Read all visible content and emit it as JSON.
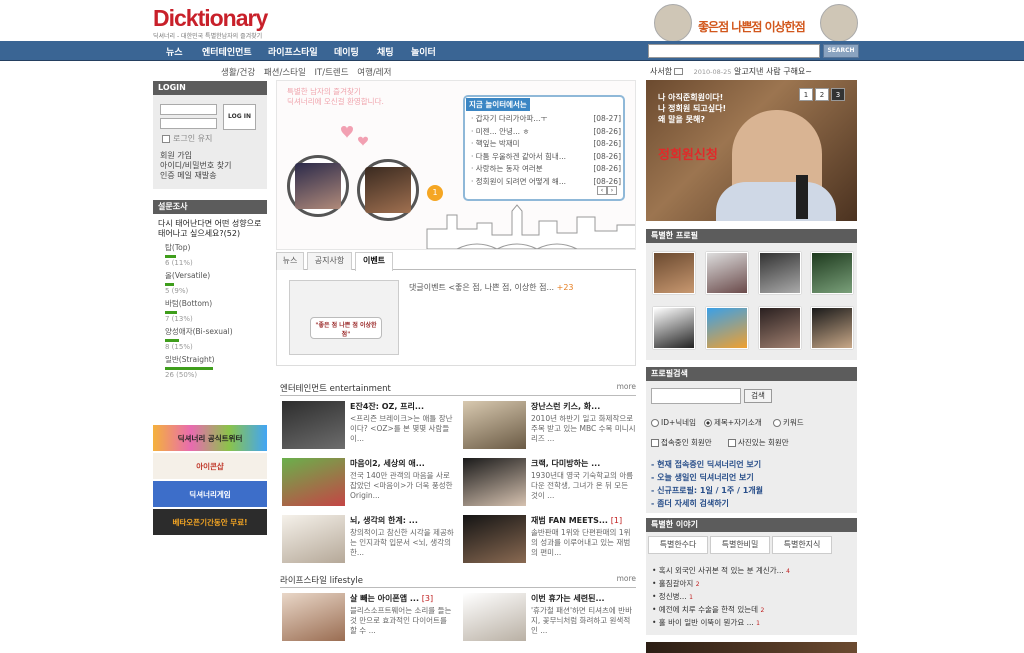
{
  "header": {
    "logo": "Dicktionary",
    "tagline": "딕셔너리 - 대한민국 특별한남자의 즐겨찾기",
    "promo_text": "좋은점 나쁜점 이상한점"
  },
  "nav": {
    "items": [
      "뉴스",
      "엔터테인먼트",
      "라이프스타일",
      "데이팅",
      "채팅",
      "놀이터"
    ],
    "search_button": "SEARCH",
    "search_placeholder": ""
  },
  "subnav": [
    "생활/건강",
    "패션/스타일",
    "IT/트렌드",
    "여행/레저"
  ],
  "login": {
    "title": "LOGIN",
    "button": "LOG IN",
    "keep_login": "로그인 유지",
    "links": [
      "회원 가입",
      "아이디/비밀번호 찾기",
      "인증 메일 재발송"
    ]
  },
  "poll": {
    "title": "설문조사",
    "question": "다시 태어난다면 어떤 성향으로 태어나고 싶으세요?(52)",
    "options": [
      {
        "label": "탑(Top)",
        "result": "6 (11%)",
        "pct": 11
      },
      {
        "label": "올(Versatile)",
        "result": "5 (9%)",
        "pct": 9
      },
      {
        "label": "바텀(Bottom)",
        "result": "7 (13%)",
        "pct": 13
      },
      {
        "label": "양성애자(Bi-sexual)",
        "result": "8 (15%)",
        "pct": 15
      },
      {
        "label": "일반(Straight)",
        "result": "26 (50%)",
        "pct": 50
      }
    ]
  },
  "left_banners": [
    "딕셔너리 공식트위터",
    "아이콘샵",
    "딕셔너리게임",
    "베타오픈기간동안 무료!"
  ],
  "hero": {
    "note_line1": "특별한 남자의 즐겨찾기",
    "note_line2": "딕셔너리에 오신걸 환영합니다.",
    "popup_title": "지금 놀이터에서는",
    "popup_items": [
      {
        "text": "갑자기 다리가아파...ㅜ",
        "date": "[08-27]"
      },
      {
        "text": "미젠... 안녕... ㅎ",
        "date": "[08-26]"
      },
      {
        "text": "핵잎는 박재미",
        "date": "[08-26]"
      },
      {
        "text": "다툼 우울하겐 같아서 힘내...",
        "date": "[08-26]"
      },
      {
        "text": "사랑하는 동자 여러분",
        "date": "[08-26]"
      },
      {
        "text": "정회원이 되려면 어떻게 해...",
        "date": "[08-26]"
      }
    ],
    "tv_labels": [
      "오늘의 인물",
      "신규회원 환영"
    ],
    "tv_badge": "1"
  },
  "tabs": [
    "뉴스",
    "공지사항",
    "이벤트"
  ],
  "event": {
    "image_caption": "\"좋은 점 나쁜 점 이상한 점\"",
    "text": "댓글이벤트 <좋은 점, 나쁜 점, 이상한 점...",
    "count": "+23"
  },
  "sections": {
    "entertainment": {
      "title": "엔터테인먼트 entertainment",
      "more": "more",
      "articles": [
        {
          "title": "E잔4잔: OZ, 프리...",
          "desc": "<프리즌 브레이크>는 애틀 장난이다? <OZ>를 본 몇몇 사람들이..."
        },
        {
          "title": "장난스런 키스, 화...",
          "desc": "2010년 하반기 일고 화제작으로 주목 받고 있는 MBC 수목 미니시리즈 ..."
        },
        {
          "title": "마음이2, 세상의 애...",
          "desc": "전국 140만 관객의 마음을 사로잡았던 <마음이>가 더욱 풍성한 Origin..."
        },
        {
          "title": "크랙, 다미방하는 ...",
          "desc": "1930년대 영국 기숙학교의 아름다운 전학생, 그녀가 온 뒤 모든 것이 ..."
        },
        {
          "title": "뇌, 생각의 한계: ...",
          "desc": "창의적이고 참신한 시각을 제공하는 인지과학 입문서 <뇌, 생각의 한..."
        },
        {
          "title": "재범 FAN MEETS...",
          "count": "[1]",
          "desc": "솔반판매 1위와 단편판매의 1위의 성과를 이루어내고 있는 재범의 편미..."
        }
      ]
    },
    "lifestyle": {
      "title": "라이프스타일 lifestyle",
      "more": "more",
      "articles": [
        {
          "title": "살 빼는 아이폰앱 ...",
          "count": "[3]",
          "desc": "블리스소프트웨어는 소리를 들는것 만으로 효과적인 다이어트를 할 수 ..."
        },
        {
          "title": "이번 휴가는 세련된...",
          "desc": "'휴가철 패션'하면 티셔츠에 반바지, 꽃무늬처럼 화려하고 원색적인 ..."
        }
      ]
    }
  },
  "right": {
    "msg_label": "사서함",
    "msg_date": "2010-08-25",
    "msg_text": "알고지낸 사람 구해요~",
    "banner": {
      "line1": "나 아직준회원이다!",
      "line2": "나 정회원 되고싶다!",
      "line3": "왜 말을 못해?",
      "big": "정회원신청",
      "pages": [
        "1",
        "2",
        "3"
      ]
    },
    "profiles_title": "특별한 프로필",
    "profile_search_title": "프로필검색",
    "profile_search_button": "검색",
    "radios": [
      {
        "label": "ID+닉네임",
        "on": false
      },
      {
        "label": "제목+자기소개",
        "on": true
      },
      {
        "label": "키워드",
        "on": false
      }
    ],
    "checks": [
      "접속중인 회원만",
      "사진있는 회원만"
    ],
    "links": [
      "- 현재 접속중인 딕셔너리언 보기",
      "- 오늘 생일인 딕셔너리언 보기",
      "- 신규프로필: 1일 / 1주 / 1개월",
      "- 좀더 자세히 검색하기"
    ],
    "stories_title": "특별한 이야기",
    "story_tabs": [
      "특별한수다",
      "특별한비밀",
      "특별한지식"
    ],
    "stories": [
      {
        "text": "• 혹시 외국인 사귀본 적 있는 분 계신가...",
        "count": "4"
      },
      {
        "text": "• 홀짐갈아지",
        "count": "2"
      },
      {
        "text": "• 정신병...",
        "count": "1"
      },
      {
        "text": "• 예전에 치루 수술을 한적 있는데",
        "count": "2"
      },
      {
        "text": "• 홀 바이 일반 이뚝이 뭔가요 ...",
        "count": "1"
      }
    ]
  },
  "colors": {
    "nav": "#3a6594",
    "dark_header": "#5c5c5c",
    "poll_bar": "#3f9e1c",
    "logo_red": "#c8202a",
    "accent_orange": "#d2571c"
  }
}
